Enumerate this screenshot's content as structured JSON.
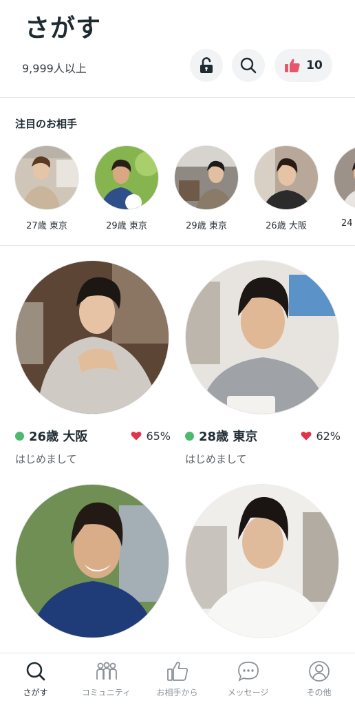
{
  "header": {
    "title": "さがす",
    "count": "9,999人以上",
    "like_count": "10"
  },
  "featured": {
    "title": "注目のお相手",
    "items": [
      {
        "label": "27歳 東京"
      },
      {
        "label": "29歳 東京"
      },
      {
        "label": "29歳 東京"
      },
      {
        "label": "26歳 大阪"
      },
      {
        "label": "24"
      }
    ]
  },
  "cards": [
    {
      "age_location": "26歳 大阪",
      "match": "65%",
      "message": "はじめまして"
    },
    {
      "age_location": "28歳 東京",
      "match": "62%",
      "message": "はじめまして"
    }
  ],
  "tabs": [
    {
      "label": "さがす",
      "icon": "search-icon"
    },
    {
      "label": "コミュニティ",
      "icon": "community-icon"
    },
    {
      "label": "お相手から",
      "icon": "thumbs-up-icon"
    },
    {
      "label": "メッセージ",
      "icon": "message-icon"
    },
    {
      "label": "その他",
      "icon": "profile-icon"
    }
  ],
  "colors": {
    "accent_pink": "#e8566b",
    "online_green": "#4cb96c",
    "heart_red": "#e0344b",
    "icon_grey": "#8a9196",
    "title_dark": "#1f2b33"
  }
}
